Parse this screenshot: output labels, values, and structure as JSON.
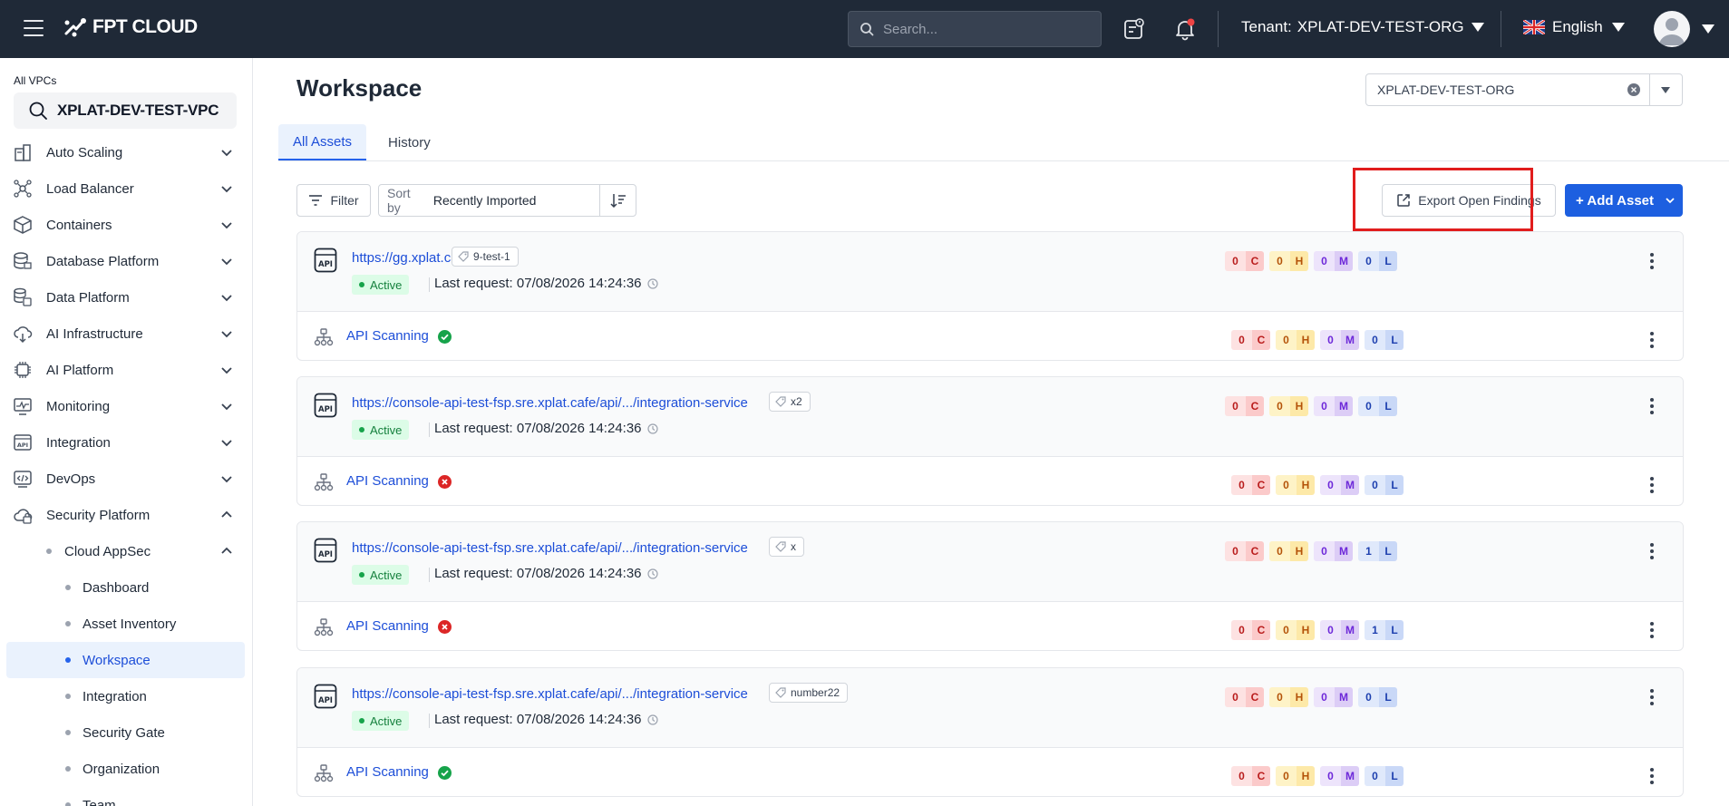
{
  "header": {
    "logo_text": "FPT CLOUD",
    "search_placeholder": "Search...",
    "tenant_label": "Tenant:",
    "tenant_value": "XPLAT-DEV-TEST-ORG",
    "language": "English"
  },
  "sidebar": {
    "vpc_label": "All VPCs",
    "vpc_value": "XPLAT-DEV-TEST-VPC",
    "items": [
      {
        "label": "Auto Scaling",
        "icon": "auto-scaling-icon",
        "expanded": false
      },
      {
        "label": "Load Balancer",
        "icon": "load-balancer-icon",
        "expanded": false
      },
      {
        "label": "Containers",
        "icon": "containers-icon",
        "expanded": false
      },
      {
        "label": "Database Platform",
        "icon": "database-icon",
        "expanded": false
      },
      {
        "label": "Data Platform",
        "icon": "data-platform-icon",
        "expanded": false
      },
      {
        "label": "AI Infrastructure",
        "icon": "ai-infrastructure-icon",
        "expanded": false
      },
      {
        "label": "AI Platform",
        "icon": "ai-platform-icon",
        "expanded": false
      },
      {
        "label": "Monitoring",
        "icon": "monitoring-icon",
        "expanded": false
      },
      {
        "label": "Integration",
        "icon": "integration-api-icon",
        "expanded": false
      },
      {
        "label": "DevOps",
        "icon": "devops-icon",
        "expanded": false
      },
      {
        "label": "Security Platform",
        "icon": "security-platform-icon",
        "expanded": true
      }
    ],
    "cloud_appsec": "Cloud AppSec",
    "sub_items": [
      {
        "label": "Dashboard",
        "active": false
      },
      {
        "label": "Asset Inventory",
        "active": false
      },
      {
        "label": "Workspace",
        "active": true
      },
      {
        "label": "Integration",
        "active": false
      },
      {
        "label": "Security Gate",
        "active": false
      },
      {
        "label": "Organization",
        "active": false
      },
      {
        "label": "Team",
        "active": false
      }
    ]
  },
  "main": {
    "title": "Workspace",
    "org_select_value": "XPLAT-DEV-TEST-ORG",
    "tabs": [
      {
        "label": "All Assets",
        "active": true
      },
      {
        "label": "History",
        "active": false
      }
    ],
    "filter_label": "Filter",
    "sort_prefix": "Sort by",
    "sort_value": "Recently Imported",
    "export_label": "Export Open Findings",
    "add_asset_label": "+ Add Asset",
    "assets": [
      {
        "url": "https://gg.xplat.cafe",
        "tag": "9-test-1",
        "status": "Active",
        "last_request": "Last request: 07/08/2026 14:24:36",
        "counts": {
          "C": "0",
          "H": "0",
          "M": "0",
          "L": "0"
        },
        "scan_label": "API Scanning",
        "scan_status": "success",
        "scan_counts": {
          "C": "0",
          "H": "0",
          "M": "0",
          "L": "0"
        }
      },
      {
        "url": "https://console-api-test-fsp.sre.xplat.cafe/api/.../integration-service",
        "tag": "x2",
        "status": "Active",
        "last_request": "Last request: 07/08/2026 14:24:36",
        "counts": {
          "C": "0",
          "H": "0",
          "M": "0",
          "L": "0"
        },
        "scan_label": "API Scanning",
        "scan_status": "error",
        "scan_counts": {
          "C": "0",
          "H": "0",
          "M": "0",
          "L": "0"
        }
      },
      {
        "url": "https://console-api-test-fsp.sre.xplat.cafe/api/.../integration-service",
        "tag": "x",
        "status": "Active",
        "last_request": "Last request: 07/08/2026 14:24:36",
        "counts": {
          "C": "0",
          "H": "0",
          "M": "0",
          "L": "1"
        },
        "scan_label": "API Scanning",
        "scan_status": "error",
        "scan_counts": {
          "C": "0",
          "H": "0",
          "M": "0",
          "L": "1"
        }
      },
      {
        "url": "https://console-api-test-fsp.sre.xplat.cafe/api/.../integration-service",
        "tag": "number22",
        "status": "Active",
        "last_request": "Last request: 07/08/2026 14:24:36",
        "counts": {
          "C": "0",
          "H": "0",
          "M": "0",
          "L": "0"
        },
        "scan_label": "API Scanning",
        "scan_status": "success",
        "scan_counts": {
          "C": "0",
          "H": "0",
          "M": "0",
          "L": "0"
        }
      }
    ]
  },
  "colors": {
    "topbar": "#1f2937",
    "primary": "#1d5fe0",
    "link": "#1d4ed8",
    "highlight": "#e11d1d",
    "success": "#16a34a",
    "error": "#dc2626"
  }
}
